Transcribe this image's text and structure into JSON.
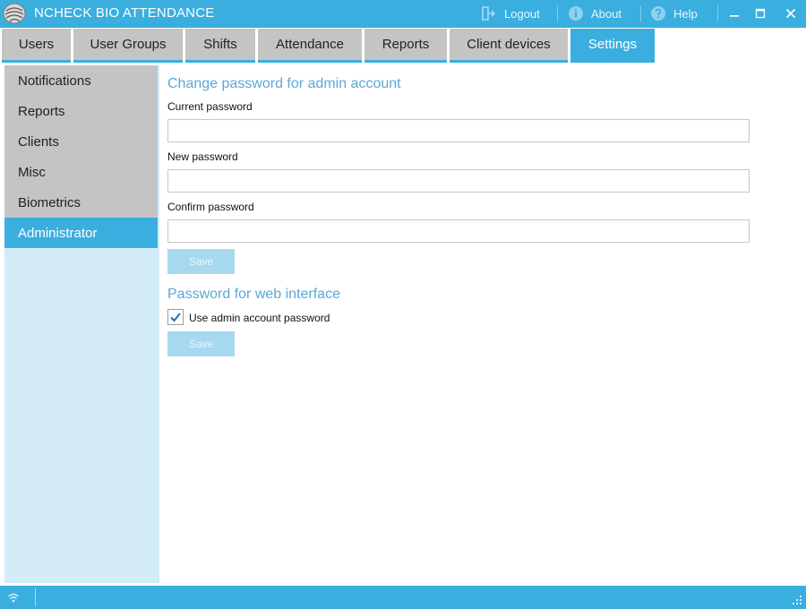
{
  "window": {
    "title": "NCHECK BIO ATTENDANCE",
    "logout_label": "Logout",
    "about_label": "About",
    "help_label": "Help"
  },
  "tabs": [
    {
      "label": "Users"
    },
    {
      "label": "User Groups"
    },
    {
      "label": "Shifts"
    },
    {
      "label": "Attendance"
    },
    {
      "label": "Reports"
    },
    {
      "label": "Client devices"
    },
    {
      "label": "Settings"
    }
  ],
  "active_tab": "Settings",
  "sidebar": {
    "items": [
      {
        "label": "Notifications"
      },
      {
        "label": "Reports"
      },
      {
        "label": "Clients"
      },
      {
        "label": "Misc"
      },
      {
        "label": "Biometrics"
      },
      {
        "label": "Administrator"
      }
    ],
    "active": "Administrator"
  },
  "admin_password": {
    "title": "Change password for admin account",
    "current_label": "Current password",
    "current_value": "",
    "new_label": "New password",
    "new_value": "",
    "confirm_label": "Confirm password",
    "confirm_value": "",
    "save_label": "Save"
  },
  "web_password": {
    "title": "Password for web interface",
    "use_admin_label": "Use admin account password",
    "use_admin_checked": true,
    "save_label": "Save"
  },
  "colors": {
    "accent": "#3aaedf",
    "tab_inactive": "#c4c4c4",
    "sidebar_bg": "#d4ecf7",
    "section_title": "#5aa9d6",
    "save_disabled": "#a6d9f0"
  },
  "icons": {
    "app_logo": "fingerprint-globe-icon",
    "logout": "logout-icon",
    "about": "info-icon",
    "help": "question-icon",
    "minimize": "minimize-icon",
    "maximize": "maximize-icon",
    "close": "close-icon",
    "status": "wifi-icon",
    "resize": "resize-grip-icon"
  }
}
